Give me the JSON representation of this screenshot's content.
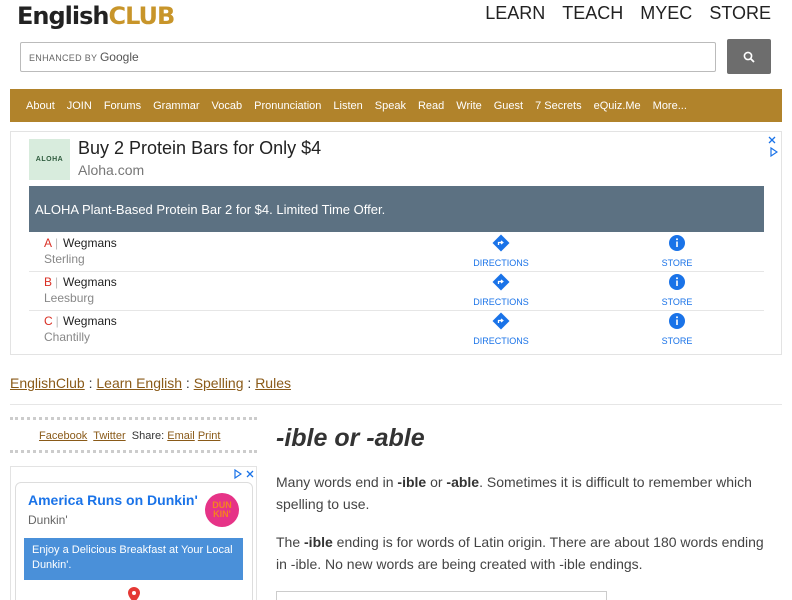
{
  "header": {
    "logo_english": "English",
    "logo_club": "CLUB",
    "topnav": [
      "LEARN",
      "TEACH",
      "MYEC",
      "STORE"
    ],
    "search_brand_small": "ENHANCED BY",
    "search_brand_google": "Google"
  },
  "mainnav": [
    "About",
    "JOIN",
    "Forums",
    "Grammar",
    "Vocab",
    "Pronunciation",
    "Listen",
    "Speak",
    "Read",
    "Write",
    "Guest",
    "7 Secrets",
    "eQuiz.Me",
    "More..."
  ],
  "ad1": {
    "logo_text": "ALOHA",
    "headline": "Buy 2 Protein Bars for Only $4",
    "domain": "Aloha.com",
    "banner": "ALOHA Plant-Based Protein Bar 2 for $4. Limited Time Offer.",
    "directions_label": "DIRECTIONS",
    "store_label": "STORE",
    "locations": [
      {
        "letter": "A",
        "name": "Wegmans",
        "city": "Sterling"
      },
      {
        "letter": "B",
        "name": "Wegmans",
        "city": "Leesburg"
      },
      {
        "letter": "C",
        "name": "Wegmans",
        "city": "Chantilly"
      }
    ]
  },
  "breadcrumb": {
    "items": [
      "EnglishClub",
      "Learn English",
      "Spelling",
      "Rules"
    ],
    "separator": ":"
  },
  "share": {
    "facebook": "Facebook",
    "twitter": "Twitter",
    "share_label": "Share:",
    "email": "Email",
    "print": "Print"
  },
  "ad2": {
    "headline": "America Runs on Dunkin'",
    "domain": "Dunkin'",
    "logo_top": "DUN",
    "logo_bottom": "KIN'",
    "banner": "Enjoy a Delicious Breakfast at Your Local Dunkin'."
  },
  "article": {
    "title": "-ible or -able",
    "p1_a": "Many words end in ",
    "p1_b": "-ible",
    "p1_c": " or ",
    "p1_d": "-able",
    "p1_e": ". Sometimes it is difficult to remember which spelling to use.",
    "p2_a": "The ",
    "p2_b": "-ible",
    "p2_c": " ending is for words of Latin origin. There are about 180 words ending in -ible. No new words are being created with -ible endings."
  },
  "colors": {
    "nav_bg": "#b1832b",
    "link": "#8a5a18",
    "ad_banner": "#5c7182",
    "ad_accent": "#1a73e8"
  }
}
